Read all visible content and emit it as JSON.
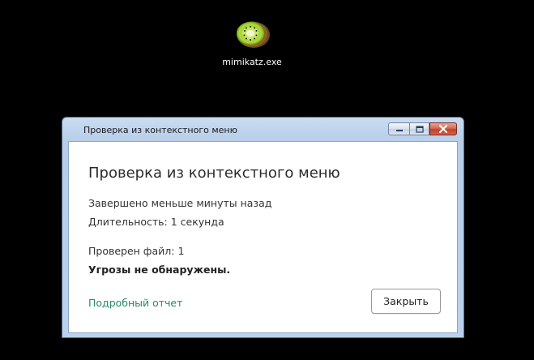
{
  "desktop": {
    "icon": {
      "name": "kiwi-icon",
      "label": "mimikatz.exe"
    }
  },
  "window": {
    "title": "Проверка из контекстного меню",
    "buttons": {
      "minimize_icon": "minimize-icon",
      "maximize_icon": "maximize-icon",
      "close_icon": "close-icon"
    }
  },
  "dialog": {
    "heading": "Проверка из контекстного меню",
    "completed": "Завершено меньше минуты назад",
    "duration": "Длительность: 1 секунда",
    "files_checked": "Проверен файл: 1",
    "threats": "Угрозы не обнаружены.",
    "report_link": "Подробный отчет",
    "close_label": "Закрыть"
  },
  "colors": {
    "link": "#248a6c",
    "background": "#000000",
    "frame": "#bcd2ec"
  }
}
